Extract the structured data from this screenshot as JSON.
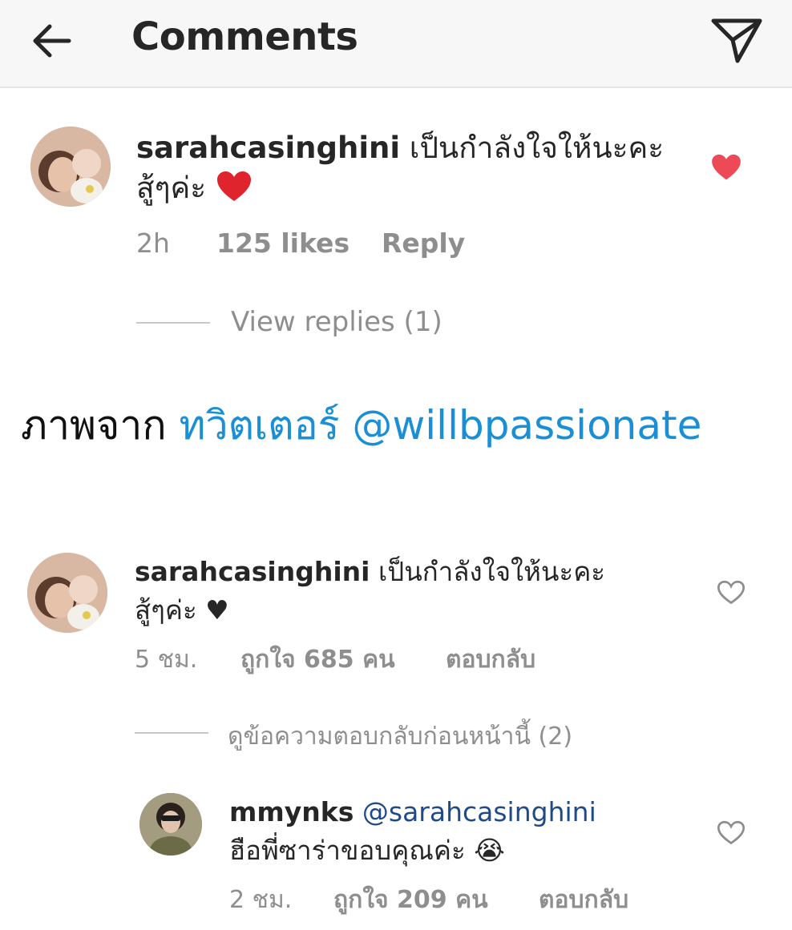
{
  "header": {
    "title": "Comments"
  },
  "comments_en": {
    "username": "sarahcasinghini",
    "text_line1": "เป็นกำลังใจให้นะคะ",
    "text_line2": "สู้ๆค่ะ",
    "emoji": "❤️",
    "time": "2h",
    "likes": "125 likes",
    "reply": "Reply",
    "view_replies": "View replies (1)",
    "liked": true
  },
  "caption": {
    "prefix": "ภาพจาก",
    "source": "ทวิตเตอร์ @willbpassionate"
  },
  "comments_th": {
    "username": "sarahcasinghini",
    "text_line1": "เป็นกำลังใจให้นะคะ",
    "text_line2": "สู้ๆค่ะ",
    "emoji": "♥",
    "time": "5 ชม.",
    "likes": "ถูกใจ 685 คน",
    "reply": "ตอบกลับ",
    "view_replies": "ดูข้อความตอบกลับก่อนหน้านี้ (2)",
    "liked": false
  },
  "reply_th": {
    "username": "mmynks",
    "mention": "@sarahcasinghini",
    "text": "ฮือพี่ซาร่าขอบคุณค่ะ",
    "emoji": "😭",
    "time": "2 ชม.",
    "likes": "ถูกใจ 209 คน",
    "reply": "ตอบกลับ",
    "liked": false
  },
  "colors": {
    "heart_liked": "#ed4956",
    "link_blue": "#1a8fd6",
    "meta_gray": "#8e8e8e"
  }
}
